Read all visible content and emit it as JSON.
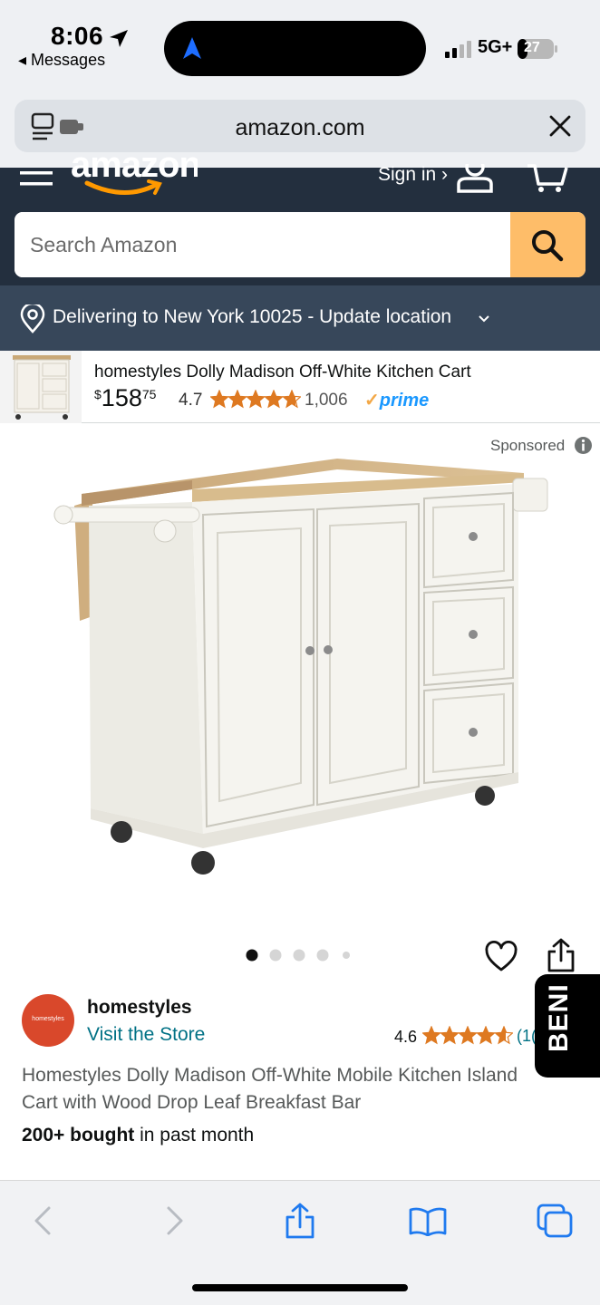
{
  "status_bar": {
    "time": "8:06",
    "back_app": "◂ Messages",
    "network": "5G+",
    "battery": "27"
  },
  "browser": {
    "url": "amazon.com"
  },
  "amazon_header": {
    "logo_text": "amazon",
    "sign_in": "Sign in ›",
    "search_placeholder": "Search Amazon",
    "delivery_text": "Delivering to New York 10025 - Update location"
  },
  "sponsored_product": {
    "title": "homestyles Dolly Madison Off-White Kitchen Cart",
    "price_dollars": "158",
    "price_cents": "75",
    "currency": "$",
    "rating": "4.7",
    "rating_stars": 4.7,
    "review_count": "1,006",
    "prime_label": "prime"
  },
  "product": {
    "sponsored_label": "Sponsored",
    "image_count": 5,
    "active_image": 0,
    "brand_logo_text": "homestyles",
    "brand_name": "homestyles",
    "visit_store": "Visit the Store",
    "rating": "4.6",
    "rating_stars": 4.6,
    "rating_count_partial": "(1(",
    "title": "Homestyles Dolly Madison Off-White Mobile Kitchen Island Cart with Wood Drop Leaf Breakfast Bar",
    "bought_bold": "200+ bought",
    "bought_rest": " in past month"
  },
  "overlay": {
    "badge_text": "BENI"
  },
  "colors": {
    "amazon_header": "#232f3e",
    "delivery_bar": "#37475a",
    "search_button": "#febd69",
    "link": "#007185",
    "star": "#de7921",
    "prime": "#1a98ff"
  }
}
